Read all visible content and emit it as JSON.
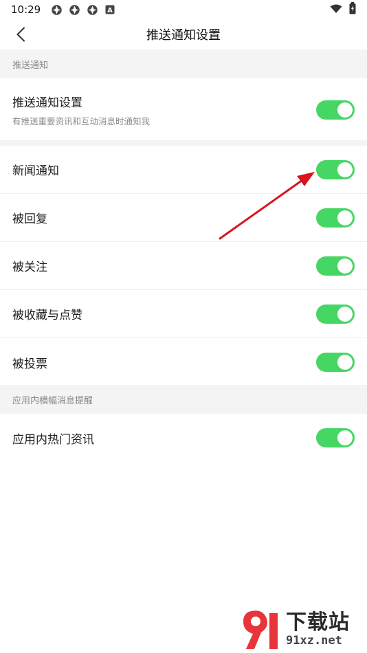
{
  "status_bar": {
    "time": "10:29",
    "icons_left": [
      "app-notify-icon",
      "app-notify-icon",
      "app-notify-icon",
      "a-badge-icon"
    ],
    "a_badge_text": "A",
    "icons_right": [
      "wifi-icon",
      "battery-icon"
    ]
  },
  "nav": {
    "title": "推送通知设置"
  },
  "sections": {
    "push": {
      "header": "推送通知"
    },
    "banner": {
      "header": "应用内横幅消息提醒"
    }
  },
  "push_main": {
    "label": "推送通知设置",
    "desc": "有推送重要资讯和互动消息时通知我",
    "enabled": true
  },
  "items": [
    {
      "label": "新闻通知",
      "enabled": true
    },
    {
      "label": "被回复",
      "enabled": true
    },
    {
      "label": "被关注",
      "enabled": true
    },
    {
      "label": "被收藏与点赞",
      "enabled": true
    },
    {
      "label": "被投票",
      "enabled": true
    }
  ],
  "banner_items": [
    {
      "label": "应用内热门资讯",
      "enabled": true
    }
  ],
  "colors": {
    "toggle_on": "#45d663",
    "arrow": "#d9141c",
    "section_bg": "#f4f4f4"
  },
  "watermark": {
    "title": "下载站",
    "url": "91xz.net"
  }
}
